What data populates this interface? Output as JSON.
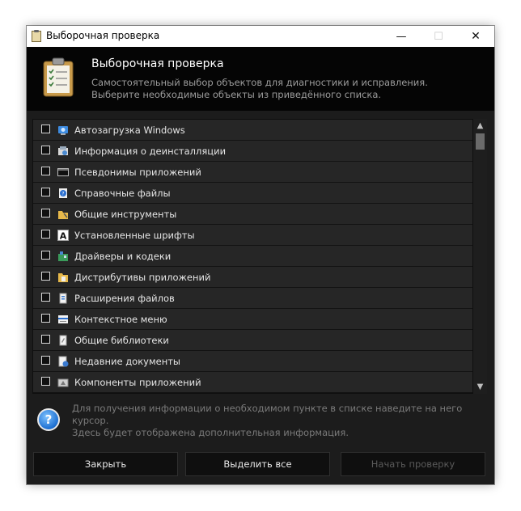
{
  "window": {
    "title": "Выборочная проверка"
  },
  "header": {
    "title": "Выборочная проверка",
    "subtitle_line1": "Самостоятельный выбор объектов для диагностики и исправления.",
    "subtitle_line2": "Выберите необходимые объекты из приведённого списка."
  },
  "items": [
    {
      "label": "Автозагрузка Windows",
      "icon": "autostart-icon",
      "checked": false
    },
    {
      "label": "Информация о деинсталляции",
      "icon": "uninstall-info-icon",
      "checked": false
    },
    {
      "label": "Псевдонимы приложений",
      "icon": "app-alias-icon",
      "checked": false
    },
    {
      "label": "Справочные файлы",
      "icon": "help-files-icon",
      "checked": false
    },
    {
      "label": "Общие инструменты",
      "icon": "shared-tools-icon",
      "checked": false
    },
    {
      "label": "Установленные шрифты",
      "icon": "fonts-icon",
      "checked": false
    },
    {
      "label": "Драйверы и кодеки",
      "icon": "drivers-codecs-icon",
      "checked": false
    },
    {
      "label": "Дистрибутивы приложений",
      "icon": "installers-icon",
      "checked": false
    },
    {
      "label": "Расширения файлов",
      "icon": "file-extensions-icon",
      "checked": false
    },
    {
      "label": "Контекстное меню",
      "icon": "context-menu-icon",
      "checked": false
    },
    {
      "label": "Общие библиотеки",
      "icon": "shared-libraries-icon",
      "checked": false
    },
    {
      "label": "Недавние документы",
      "icon": "recent-documents-icon",
      "checked": false
    },
    {
      "label": "Компоненты приложений",
      "icon": "app-components-icon",
      "checked": false
    }
  ],
  "info": {
    "line1": "Для получения информации о необходимом пункте в списке наведите на него курсор.",
    "line2": "Здесь будет отображена дополнительная информация.",
    "icon": "question-icon"
  },
  "buttons": {
    "close": "Закрыть",
    "select_all": "Выделить все",
    "start": "Начать проверку"
  },
  "colors": {
    "window_bg": "#1c1c1c",
    "header_bg": "#050505",
    "row_bg": "#262626",
    "disabled_text": "#5a5a5a"
  }
}
